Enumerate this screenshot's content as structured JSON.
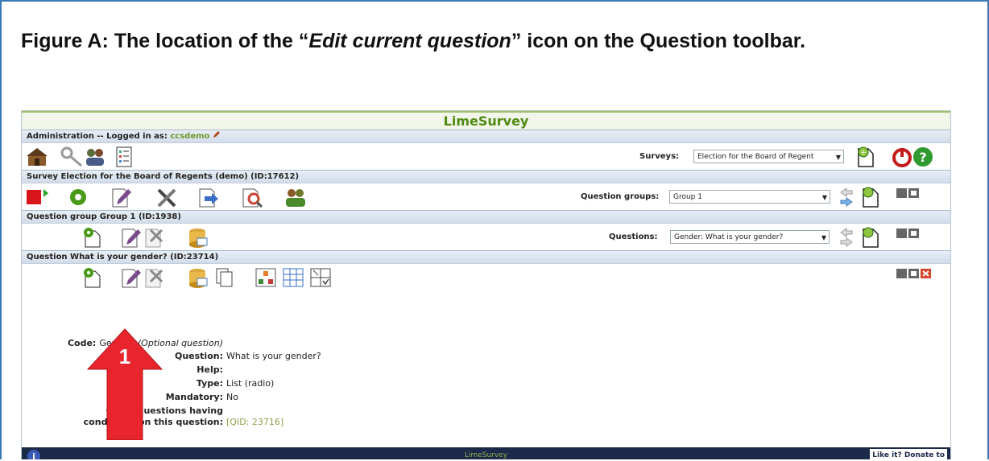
{
  "caption": {
    "prefix": "Figure A:  The location of the “",
    "italic": "Edit current question",
    "suffix": "” icon on the Question toolbar."
  },
  "app": {
    "title": "LimeSurvey",
    "admin_bar": {
      "label": "Administration -- Logged in as: ",
      "user": "ccsdemo"
    },
    "surveys": {
      "label": "Surveys:",
      "selected": "Election for the Board of Regent"
    },
    "survey_bar": {
      "label": "Survey Election for the Board of Regents (demo) (ID:17612)"
    },
    "question_groups": {
      "label": "Question groups:",
      "selected": "Group 1"
    },
    "group_bar": {
      "label": "Question group Group 1 (ID:1938)"
    },
    "questions": {
      "label": "Questions:",
      "selected": "Gender: What is your gender?"
    },
    "question_bar": {
      "label": "Question What is your gender? (ID:23714)"
    },
    "details": {
      "code_label": "Code:",
      "code_value": "Gender: ",
      "code_optional": "(Optional question)",
      "question_label": "Question:",
      "question_value": "What is your gender?",
      "help_label": "Help:",
      "type_label": "Type:",
      "type_value": "List (radio)",
      "mandatory_label": "Mandatory:",
      "mandatory_value": "No",
      "conditions_label_1": "Other questions having",
      "conditions_label_2": "conditions on this question:",
      "conditions_value": "[QID: 23716]"
    },
    "footer": {
      "text": "LimeSurvey",
      "donate": "Like it? Donate to"
    }
  },
  "annotation": {
    "arrow_number": "1",
    "arrow_color": "#e8242c"
  },
  "colors": {
    "accent_green": "#4f8a10",
    "frame_blue": "#3b78b8",
    "footer_bg": "#1c2a4a"
  }
}
